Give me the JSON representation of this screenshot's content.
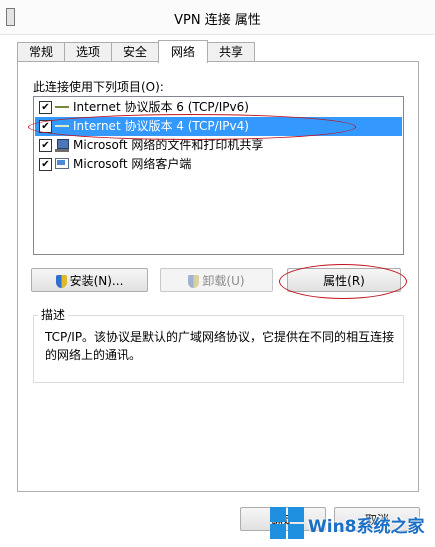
{
  "window": {
    "title": "VPN 连接 属性"
  },
  "tabs": [
    {
      "label": "常规"
    },
    {
      "label": "选项"
    },
    {
      "label": "安全"
    },
    {
      "label": "网络",
      "active": true
    },
    {
      "label": "共享"
    }
  ],
  "network": {
    "items_label": "此连接使用下列项目(O):",
    "items": [
      {
        "label": "Internet 协议版本 6 (TCP/IPv6)",
        "checked": true,
        "icon": "protocol-icon"
      },
      {
        "label": "Internet 协议版本 4 (TCP/IPv4)",
        "checked": true,
        "selected": true,
        "icon": "protocol-icon"
      },
      {
        "label": "Microsoft 网络的文件和打印机共享",
        "checked": true,
        "icon": "computer-icon"
      },
      {
        "label": "Microsoft 网络客户端",
        "checked": true,
        "icon": "network-client-icon"
      }
    ],
    "buttons": {
      "install": "安装(N)...",
      "uninstall": "卸载(U)",
      "properties": "属性(R)"
    },
    "description": {
      "legend": "描述",
      "text": "TCP/IP。该协议是默认的广域网络协议，它提供在不同的相互连接的网络上的通讯。"
    }
  },
  "footer": {
    "ok": "确定",
    "cancel": "取消"
  },
  "watermark": {
    "text": "Win8系统之家"
  },
  "colors": {
    "selection": "#3399ff",
    "annotation_red": "#c0121c",
    "watermark_blue": "#1a6fc6"
  }
}
